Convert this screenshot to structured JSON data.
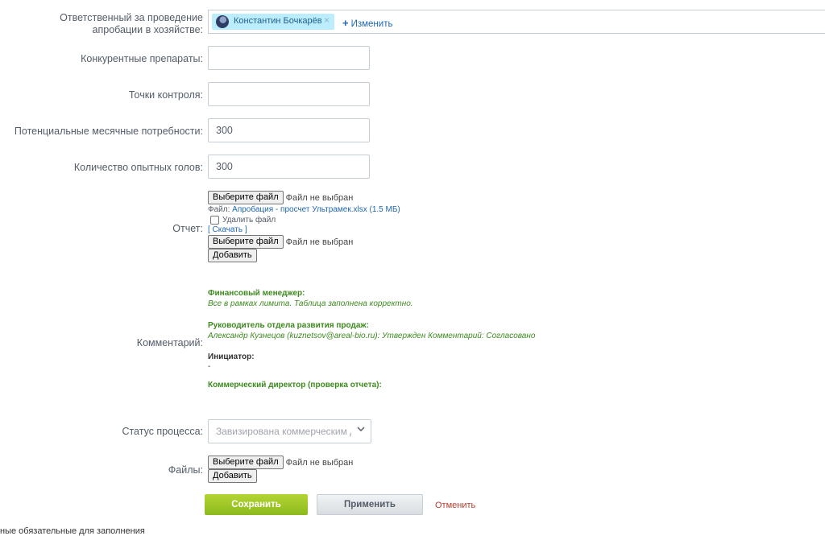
{
  "responsible": {
    "label": "Ответственный за проведение апробации в хозяйстве:",
    "user_name": "Константин Бочкарёв",
    "remove_glyph": "×",
    "change_glyph": "+",
    "change_label": "Изменить"
  },
  "fields": {
    "competitors_label": "Конкурентные препараты:",
    "competitors_value": "",
    "control_points_label": "Точки контроля:",
    "control_points_value": "",
    "monthly_needs_label": "Потенциальные месячные потребности:",
    "monthly_needs_value": "300",
    "heads_label": "Количество опытных голов:",
    "heads_value": "300"
  },
  "report": {
    "label": "Отчет:",
    "choose_file": "Выберите файл",
    "no_file": "Файл не выбран",
    "file_prefix": "Файл:",
    "file_name": "Апробация - просчет Ультрамек.xlsx (1.5 МБ)",
    "delete_file": "Удалить файл",
    "download": "[ Скачать ]",
    "choose_file_2": "Выберите файл",
    "no_file_2": "Файл не выбран",
    "add": "Добавить"
  },
  "comments": {
    "label": "Комментарий:",
    "entries": [
      {
        "role": "Финансовый менеджер:",
        "text": "Все в рамках лимита. Таблица заполнена корректно."
      },
      {
        "role": "Руководитель отдела развития продаж:",
        "text": "Александр Кузнецов (kuznetsov@areal-bio.ru): Утвержден Комментарий: Согласовано"
      },
      {
        "role": "Инициатор:",
        "text": "-"
      },
      {
        "role": "Коммерческий директор (проверка отчета):",
        "text": ""
      }
    ]
  },
  "status": {
    "label": "Статус процесса:",
    "value": "Завизирована коммерческим ди"
  },
  "files": {
    "label": "Файлы:",
    "choose_file": "Выберите файл",
    "no_file": "Файл не выбран",
    "add": "Добавить"
  },
  "actions": {
    "save": "Сохранить",
    "apply": "Применить",
    "cancel": "Отменить"
  },
  "footnote": "ные обязательные для заполнения"
}
